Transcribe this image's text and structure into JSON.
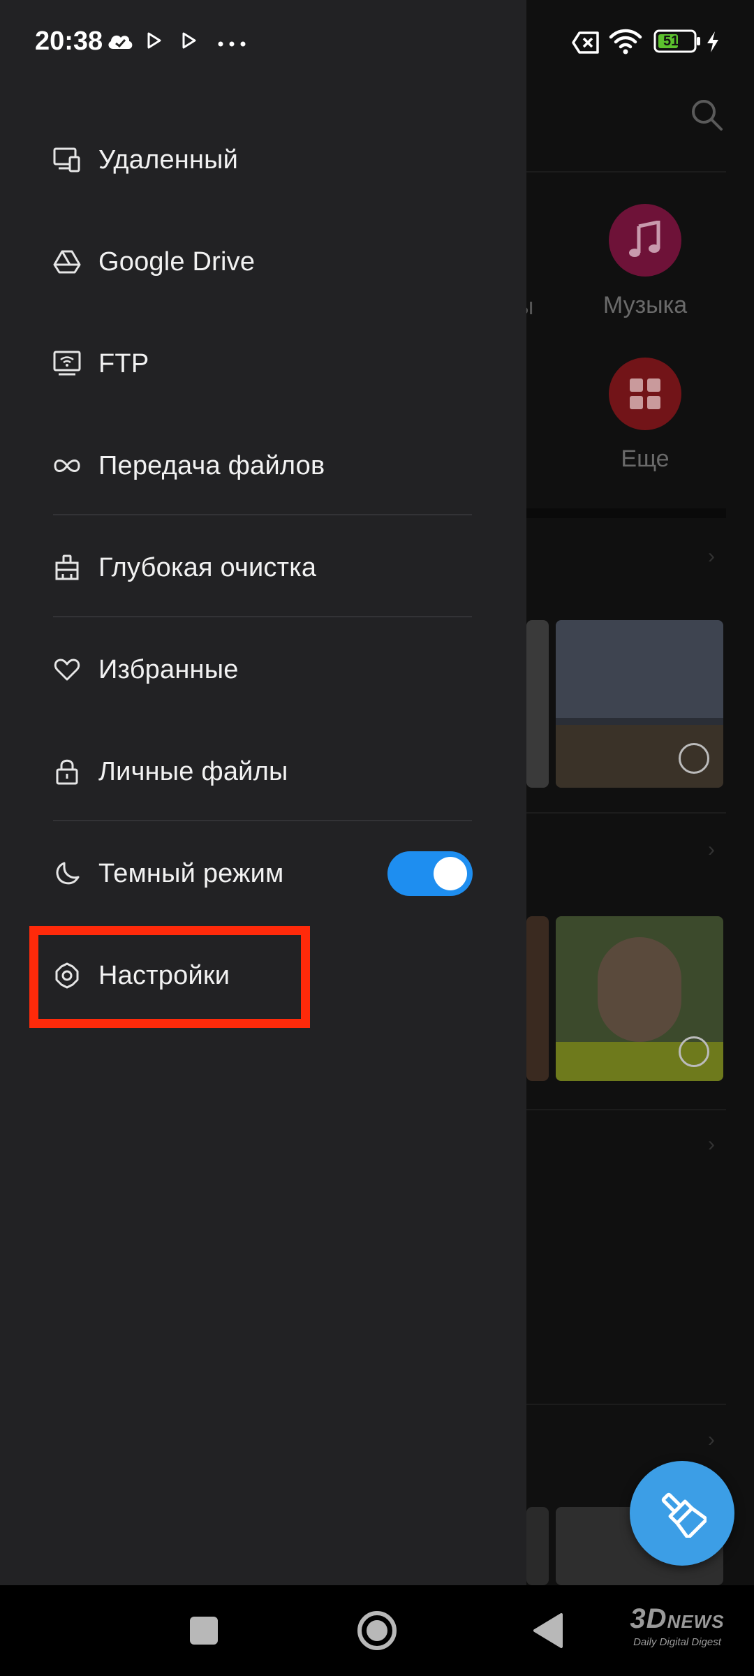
{
  "status_bar": {
    "time": "20:38",
    "battery_level": "51"
  },
  "background": {
    "categories": [
      {
        "label": "Музыка",
        "icon": "music-note-icon",
        "color": "#b2195a"
      },
      {
        "label": "Еще",
        "icon": "grid-icon",
        "color": "#b71c24"
      }
    ],
    "partial_label": "ы"
  },
  "drawer": {
    "items": [
      {
        "label": "Удаленный",
        "icon": "remote-device-icon"
      },
      {
        "label": "Google Drive",
        "icon": "google-drive-icon"
      },
      {
        "label": "FTP",
        "icon": "ftp-icon"
      },
      {
        "label": "Передача файлов",
        "icon": "file-transfer-icon"
      },
      {
        "label": "Глубокая очистка",
        "icon": "deep-clean-icon"
      },
      {
        "label": "Избранные",
        "icon": "heart-icon"
      },
      {
        "label": "Личные файлы",
        "icon": "lock-icon"
      },
      {
        "label": "Темный режим",
        "icon": "moon-icon",
        "toggle_on": true
      },
      {
        "label": "Настройки",
        "icon": "gear-icon"
      }
    ],
    "highlight_color": "#ff2a0a",
    "toggle_color": "#1e8ef0"
  },
  "watermark": {
    "line1_big": "3D",
    "line1_small": "NEWS",
    "line2": "Daily Digital Digest"
  }
}
